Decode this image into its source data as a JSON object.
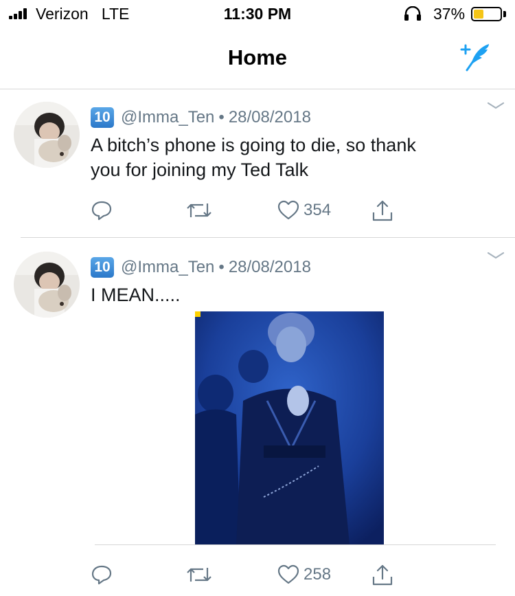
{
  "status_bar": {
    "carrier": "Verizon",
    "network": "LTE",
    "time": "11:30 PM",
    "battery_percent": "37%",
    "battery_level": 0.37
  },
  "nav": {
    "title": "Home",
    "compose_icon": "compose-tweet-icon"
  },
  "tweets": [
    {
      "badge": "10",
      "handle": "@Imma_Ten",
      "separator": "•",
      "date": "28/08/2018",
      "text_line1": "A bitch’s phone is going to die, so thank",
      "text_line2": "you for joining my Ted Talk",
      "likes": "354"
    },
    {
      "badge": "10",
      "handle": "@Imma_Ten",
      "separator": "•",
      "date": "28/08/2018",
      "text_line1": "I MEAN.....",
      "likes": "258"
    }
  ],
  "colors": {
    "accent": "#1da1f2",
    "secondary_text": "#657786",
    "battery": "#f5c518"
  }
}
